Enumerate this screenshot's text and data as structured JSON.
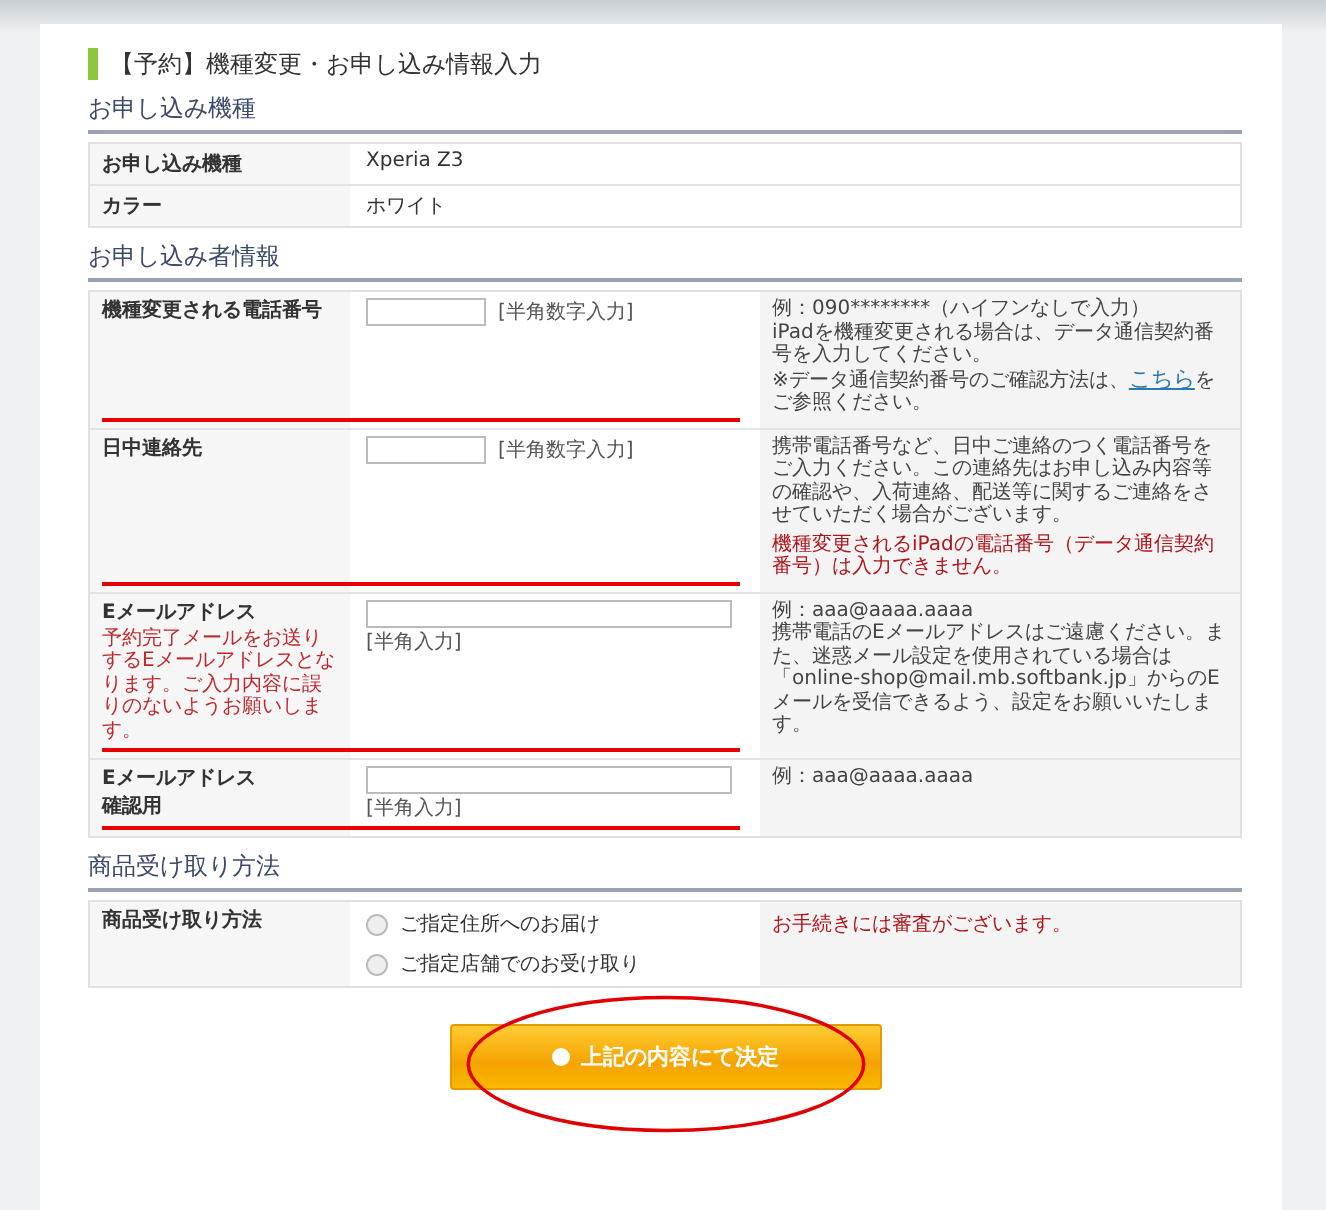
{
  "page_title": "【予約】機種変更・お申し込み情報入力",
  "sections": [
    {
      "kind": "info",
      "heading": "お申し込み機種",
      "rows": [
        {
          "label": "お申し込み機種",
          "value": "Xperia Z3"
        },
        {
          "label": "カラー",
          "value": "ホワイト"
        }
      ]
    },
    {
      "kind": "form",
      "heading": "お申し込み者情報",
      "rows": [
        {
          "label": "機種変更される電話番号",
          "kind": "short",
          "hint": "[半角数字入力]",
          "underlined": true,
          "notes": [
            {
              "kind": "text",
              "text": "例：090********（ハイフンなしで入力）"
            },
            {
              "kind": "text",
              "text": "iPadを機種変更される場合は、データ通信契約番号を入力してください。"
            },
            {
              "kind": "link",
              "text": "※データ通信契約番号のご確認方法は、",
              "link": "こちら",
              "after": "をご参照ください。"
            }
          ]
        },
        {
          "label": "日中連絡先",
          "kind": "short",
          "hint": "[半角数字入力]",
          "underlined": true,
          "notes": [
            {
              "kind": "text",
              "text": "携帯電話番号など、日中ご連絡のつく電話番号をご入力ください。この連絡先はお申し込み内容等の確認や、入荷連絡、配送等に関するご連絡をさせていただく場合がございます。"
            },
            {
              "kind": "warning",
              "text": "機種変更されるiPadの電話番号（データ通信契約番号）は入力できません。"
            }
          ]
        },
        {
          "label": "Eメールアドレス",
          "label_note": "予約完了メールをお送りするEメールアドレスとなります。ご入力内容に誤りのないようお願いします。",
          "kind": "long",
          "hint": "[半角入力]",
          "underlined": true,
          "notes": [
            {
              "kind": "text",
              "text": "例：aaa@aaaa.aaaa"
            },
            {
              "kind": "text",
              "text": "携帯電話のEメールアドレスはご遠慮ください。また、迷惑メール設定を使用されている場合は「online-shop@mail.mb.softbank.jp」からのEメールを受信できるよう、設定をお願いいたします。"
            }
          ]
        },
        {
          "label": "Eメールアドレス",
          "label_sub": "確認用",
          "kind": "long",
          "hint": "[半角入力]",
          "underlined": true,
          "notes": [
            {
              "kind": "text",
              "text": "例：aaa@aaaa.aaaa"
            }
          ]
        }
      ]
    },
    {
      "kind": "choice",
      "heading": "商品受け取り方法",
      "rows": [
        {
          "label": "商品受け取り方法",
          "options": [
            {
              "label": "ご指定住所へのお届け",
              "selected": false
            },
            {
              "label": "ご指定店舗でのお受け取り",
              "selected": false
            }
          ],
          "notes": [
            {
              "kind": "warning",
              "text": "お手続きには審査がございます。"
            }
          ]
        }
      ]
    }
  ],
  "submit": {
    "label": "上記の内容にて決定",
    "circled": true
  }
}
